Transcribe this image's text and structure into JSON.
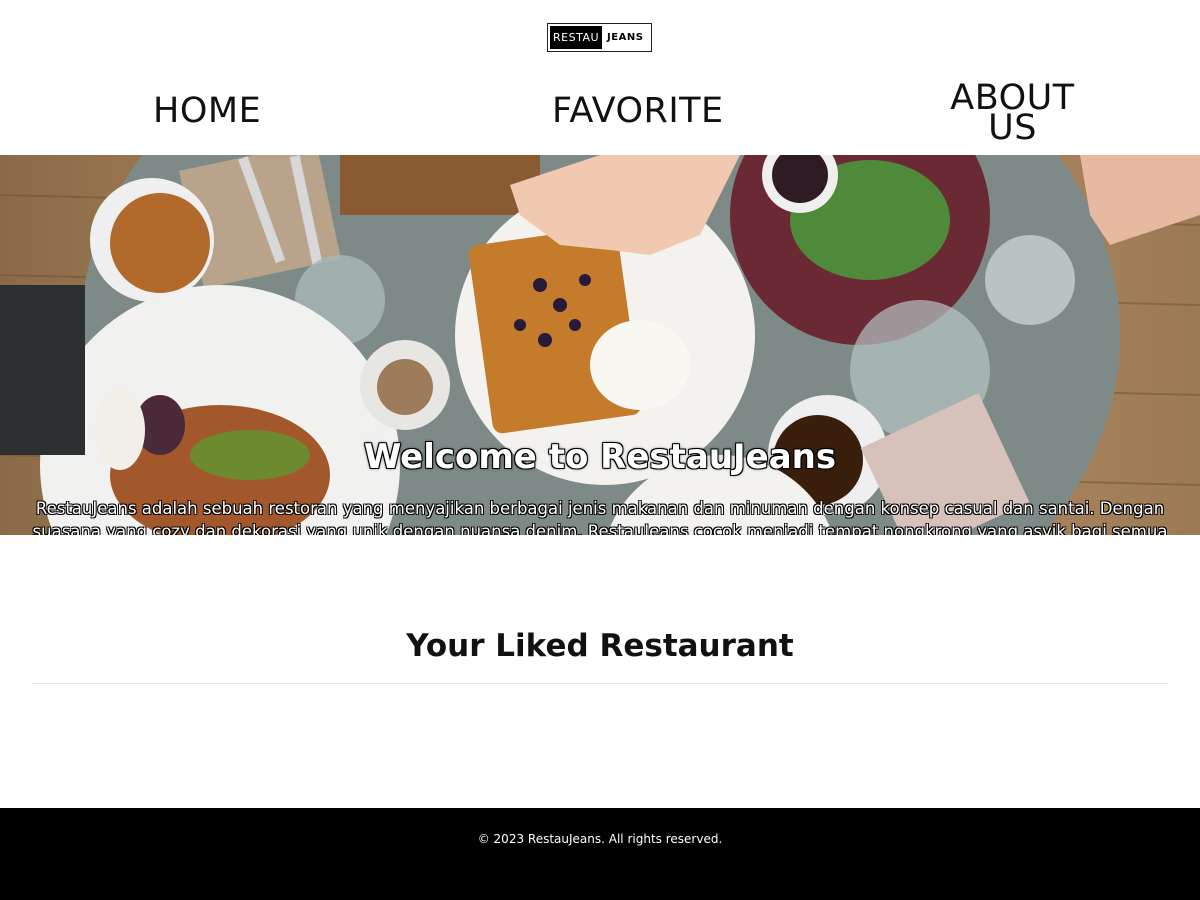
{
  "header": {
    "logo_part1": "RESTAU",
    "logo_part2": "JEANS"
  },
  "nav": {
    "home": "HOME",
    "favorite": "FAVORITE",
    "about_line1": "ABOUT",
    "about_line2": "US"
  },
  "hero": {
    "title": "Welcome to RestauJeans",
    "description": "RestauJeans adalah sebuah restoran yang menyajikan berbagai jenis makanan dan minuman dengan konsep casual dan santai. Dengan suasana yang cozy dan dekorasi yang unik dengan nuansa denim, RestauJeans cocok menjadi tempat nongkrong yang asyik bagi semua kalangan."
  },
  "liked": {
    "title": "Your Liked Restaurant"
  },
  "footer": {
    "copyright": "© 2023 RestauJeans. All rights reserved."
  },
  "colors": {
    "footer_bg": "#000000",
    "page_bg": "#ffffff",
    "table": "#7f8c8a",
    "floor": "#b08a62"
  }
}
